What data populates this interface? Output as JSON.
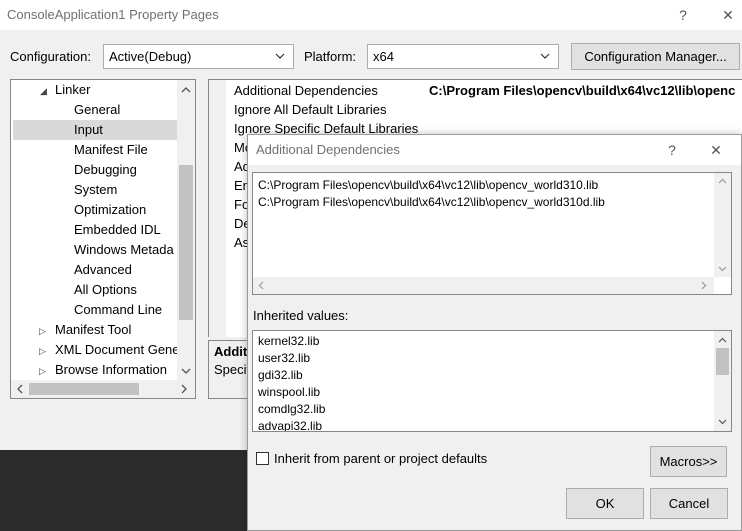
{
  "window": {
    "title": "ConsoleApplication1 Property Pages",
    "help_label": "?",
    "close_label": "✕"
  },
  "toolbar": {
    "configuration_label": "Configuration:",
    "configuration_value": "Active(Debug)",
    "platform_label": "Platform:",
    "platform_value": "x64",
    "config_manager_label": "Configuration Manager..."
  },
  "tree": {
    "items": [
      {
        "label": "Linker",
        "expander": "◢"
      },
      {
        "label": "General"
      },
      {
        "label": "Input",
        "selected": true
      },
      {
        "label": "Manifest File"
      },
      {
        "label": "Debugging"
      },
      {
        "label": "System"
      },
      {
        "label": "Optimization"
      },
      {
        "label": "Embedded IDL"
      },
      {
        "label": "Windows Metada"
      },
      {
        "label": "Advanced"
      },
      {
        "label": "All Options"
      },
      {
        "label": "Command Line"
      },
      {
        "label": "Manifest Tool",
        "expander": "▷"
      },
      {
        "label": "XML Document Gene",
        "expander": "▷"
      },
      {
        "label": "Browse Information",
        "expander": "▷"
      }
    ]
  },
  "grid": {
    "rows": [
      {
        "name": "Additional Dependencies",
        "value": "C:\\Program Files\\opencv\\build\\x64\\vc12\\lib\\openc"
      },
      {
        "name": "Ignore All Default Libraries",
        "value": ""
      },
      {
        "name": "Ignore Specific Default Libraries",
        "value": ""
      },
      {
        "name": "Mo",
        "value": ""
      },
      {
        "name": "Ad",
        "value": ""
      },
      {
        "name": "Em",
        "value": ""
      },
      {
        "name": "Fo",
        "value": ""
      },
      {
        "name": "De",
        "value": ""
      },
      {
        "name": "As",
        "value": ""
      }
    ],
    "description_title": "Additi",
    "description_text": "Specif"
  },
  "dialog": {
    "title": "Additional Dependencies",
    "help_label": "?",
    "close_label": "✕",
    "lines": [
      "C:\\Program Files\\opencv\\build\\x64\\vc12\\lib\\opencv_world310.lib",
      "C:\\Program Files\\opencv\\build\\x64\\vc12\\lib\\opencv_world310d.lib"
    ],
    "inherited_label": "Inherited values:",
    "inherited": [
      "kernel32.lib",
      "user32.lib",
      "gdi32.lib",
      "winspool.lib",
      "comdlg32.lib",
      "advapi32.lib"
    ],
    "inherit_checkbox_label": "Inherit from parent or project defaults",
    "inherit_checked": false,
    "macros_label": "Macros>>",
    "ok_label": "OK",
    "cancel_label": "Cancel"
  }
}
